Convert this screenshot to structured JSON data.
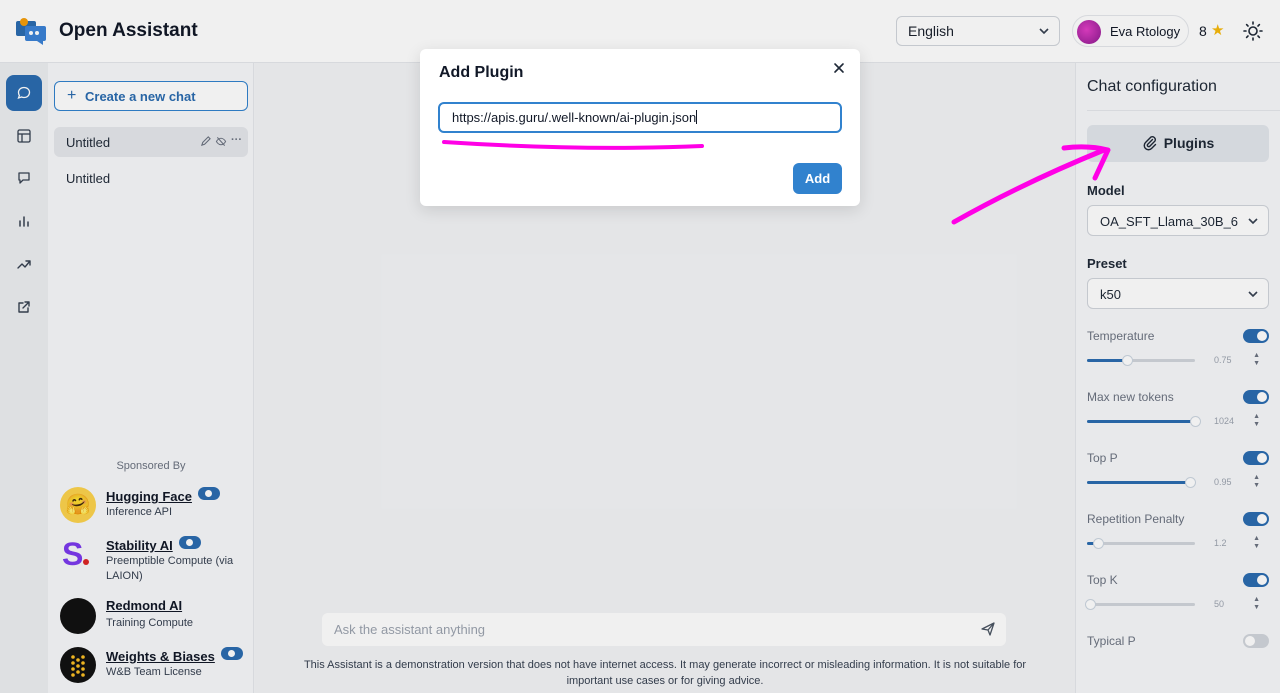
{
  "app": {
    "title": "Open Assistant",
    "language": "English",
    "user_name": "Eva Rtology",
    "score": "8",
    "accent_color": "#3182ce"
  },
  "rail": {
    "icons": [
      "chat-icon",
      "layout-icon",
      "message-icon",
      "bar-chart-icon",
      "trending-icon",
      "external-link-icon"
    ]
  },
  "sidebar": {
    "new_chat_label": "Create a new chat",
    "chats": [
      {
        "title": "Untitled"
      },
      {
        "title": "Untitled"
      }
    ],
    "sponsored_by": "Sponsored By",
    "sponsors": [
      {
        "name": "Hugging Face",
        "desc": "Inference API"
      },
      {
        "name": "Stability AI",
        "desc": "Preemptible Compute (via LAION)"
      },
      {
        "name": "Redmond AI",
        "desc": "Training Compute"
      },
      {
        "name": "Weights & Biases",
        "desc": "W&B Team License"
      }
    ]
  },
  "main": {
    "input_placeholder": "Ask the assistant anything",
    "disclaimer": "This Assistant is a demonstration version that does not have internet access. It may generate incorrect or misleading information. It is not suitable for important use cases or for giving advice."
  },
  "config": {
    "title": "Chat configuration",
    "plugins_label": "Plugins",
    "model_label": "Model",
    "model_value": "OA_SFT_Llama_30B_6",
    "preset_label": "Preset",
    "preset_value": "k50",
    "params": [
      {
        "label": "Temperature",
        "value": "0.75",
        "enabled": true,
        "level": 0.37
      },
      {
        "label": "Max new tokens",
        "value": "1024",
        "enabled": true,
        "level": 1.0
      },
      {
        "label": "Top P",
        "value": "0.95",
        "enabled": true,
        "level": 0.95
      },
      {
        "label": "Repetition Penalty",
        "value": "1.2",
        "enabled": true,
        "level": 0.1
      },
      {
        "label": "Top K",
        "value": "50",
        "enabled": true,
        "level": 0.03
      },
      {
        "label": "Typical P",
        "value": "",
        "enabled": false
      }
    ]
  },
  "modal": {
    "title": "Add Plugin",
    "url_value": "https://apis.guru/.well-known/ai-plugin.json",
    "add_label": "Add"
  }
}
